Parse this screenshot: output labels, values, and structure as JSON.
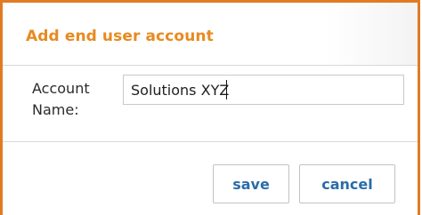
{
  "dialog": {
    "title": "Add end user account",
    "accent_color": "#e07b24",
    "title_color": "#e88a1f"
  },
  "form": {
    "account_name": {
      "label_line1": "Account",
      "label_line2": "Name:",
      "value": "Solutions XYZ"
    }
  },
  "actions": {
    "save_label": "save",
    "cancel_label": "cancel",
    "button_text_color": "#2a6ca8"
  }
}
